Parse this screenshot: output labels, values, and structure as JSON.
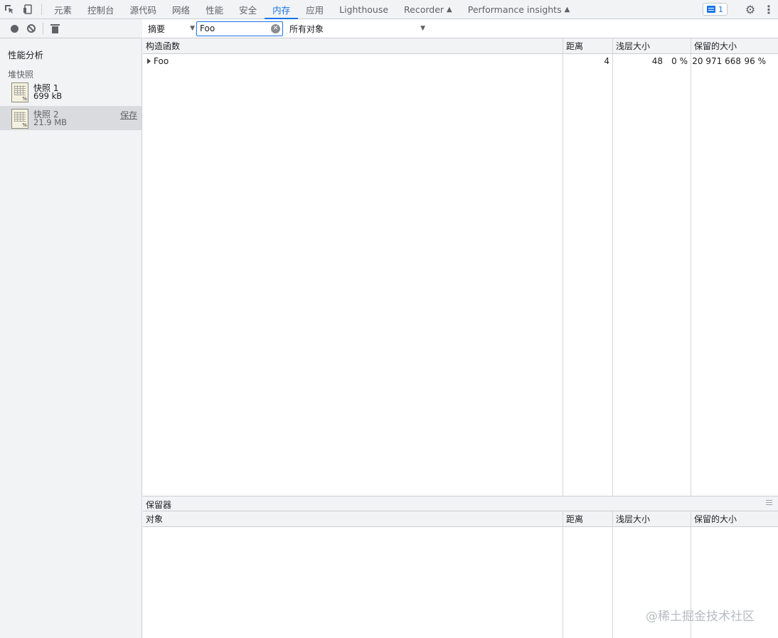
{
  "topbar": {
    "tabs": [
      {
        "label": "元素",
        "active": false,
        "flask": false
      },
      {
        "label": "控制台",
        "active": false,
        "flask": false
      },
      {
        "label": "源代码",
        "active": false,
        "flask": false
      },
      {
        "label": "网络",
        "active": false,
        "flask": false
      },
      {
        "label": "性能",
        "active": false,
        "flask": false
      },
      {
        "label": "安全",
        "active": false,
        "flask": false
      },
      {
        "label": "内存",
        "active": true,
        "flask": false
      },
      {
        "label": "应用",
        "active": false,
        "flask": false
      },
      {
        "label": "Lighthouse",
        "active": false,
        "flask": false
      },
      {
        "label": "Recorder",
        "active": false,
        "flask": true
      },
      {
        "label": "Performance insights",
        "active": false,
        "flask": true
      }
    ],
    "issues_count": "1"
  },
  "sidebar": {
    "title": "性能分析",
    "section": "堆快照",
    "snapshots": [
      {
        "name": "快照 1",
        "size": "699 kB",
        "selected": false,
        "save": ""
      },
      {
        "name": "快照 2",
        "size": "21.9 MB",
        "selected": true,
        "save": "保存"
      }
    ]
  },
  "toolbar": {
    "view_select": "摘要",
    "filter_value": "Foo",
    "objects_select": "所有对象"
  },
  "main_grid": {
    "headers": [
      "构造函数",
      "距离",
      "浅层大小",
      "保留的大小"
    ],
    "rows": [
      {
        "constructor": "Foo",
        "distance": "4",
        "shallow": "48",
        "shallow_pct": "0 %",
        "retained": "20 971 668",
        "retained_pct": "96 %"
      }
    ]
  },
  "retainers": {
    "title": "保留器",
    "headers": [
      "对象",
      "距离",
      "浅层大小",
      "保留的大小"
    ]
  },
  "watermark": "@稀土掘金技术社区"
}
